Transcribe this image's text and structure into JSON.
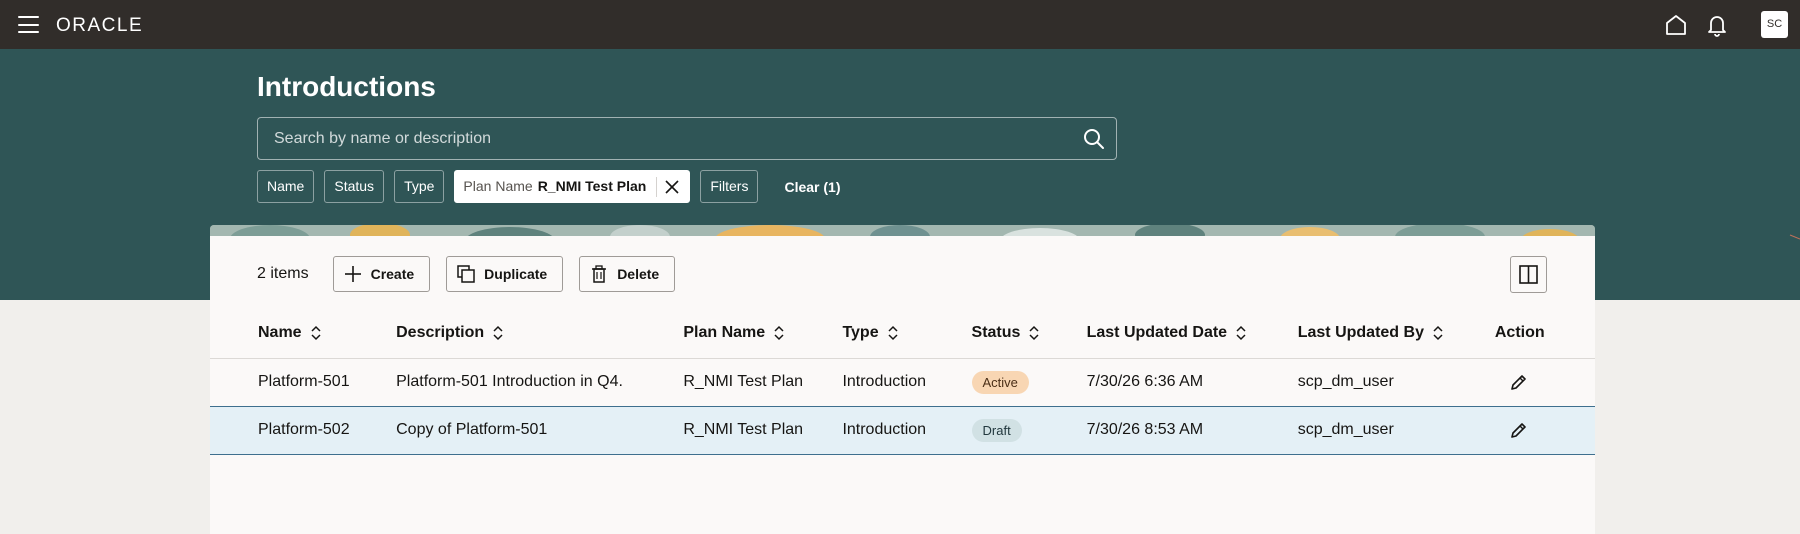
{
  "topbar": {
    "logo": "ORACLE",
    "avatar_initials": "SC"
  },
  "page": {
    "title": "Introductions"
  },
  "search": {
    "placeholder": "Search by name or description"
  },
  "filters": {
    "chips": [
      "Name",
      "Status",
      "Type"
    ],
    "active_chip": {
      "label": "Plan Name",
      "value": "R_NMI Test Plan"
    },
    "filters_label": "Filters",
    "clear_label": "Clear (1)"
  },
  "toolbar": {
    "item_count": "2 items",
    "create_label": "Create",
    "duplicate_label": "Duplicate",
    "delete_label": "Delete"
  },
  "table": {
    "columns": [
      "Name",
      "Description",
      "Plan Name",
      "Type",
      "Status",
      "Last Updated Date",
      "Last Updated By",
      "Action"
    ],
    "rows": [
      {
        "name": "Platform-501",
        "description": "Platform-501 Introduction in Q4.",
        "plan_name": "R_NMI Test Plan",
        "type": "Introduction",
        "status": "Active",
        "updated_date": "7/30/26 6:36 AM",
        "updated_by": "scp_dm_user"
      },
      {
        "name": "Platform-502",
        "description": "Copy of Platform-501",
        "plan_name": "R_NMI Test Plan",
        "type": "Introduction",
        "status": "Draft",
        "updated_date": "7/30/26 8:53 AM",
        "updated_by": "scp_dm_user"
      }
    ]
  },
  "colors": {
    "topbar": "#312d2a",
    "hero": "#2f5556",
    "badge_active": "#f8d6b3",
    "badge_draft": "#d1e1e4",
    "selected_row": "#e4f0f6"
  }
}
